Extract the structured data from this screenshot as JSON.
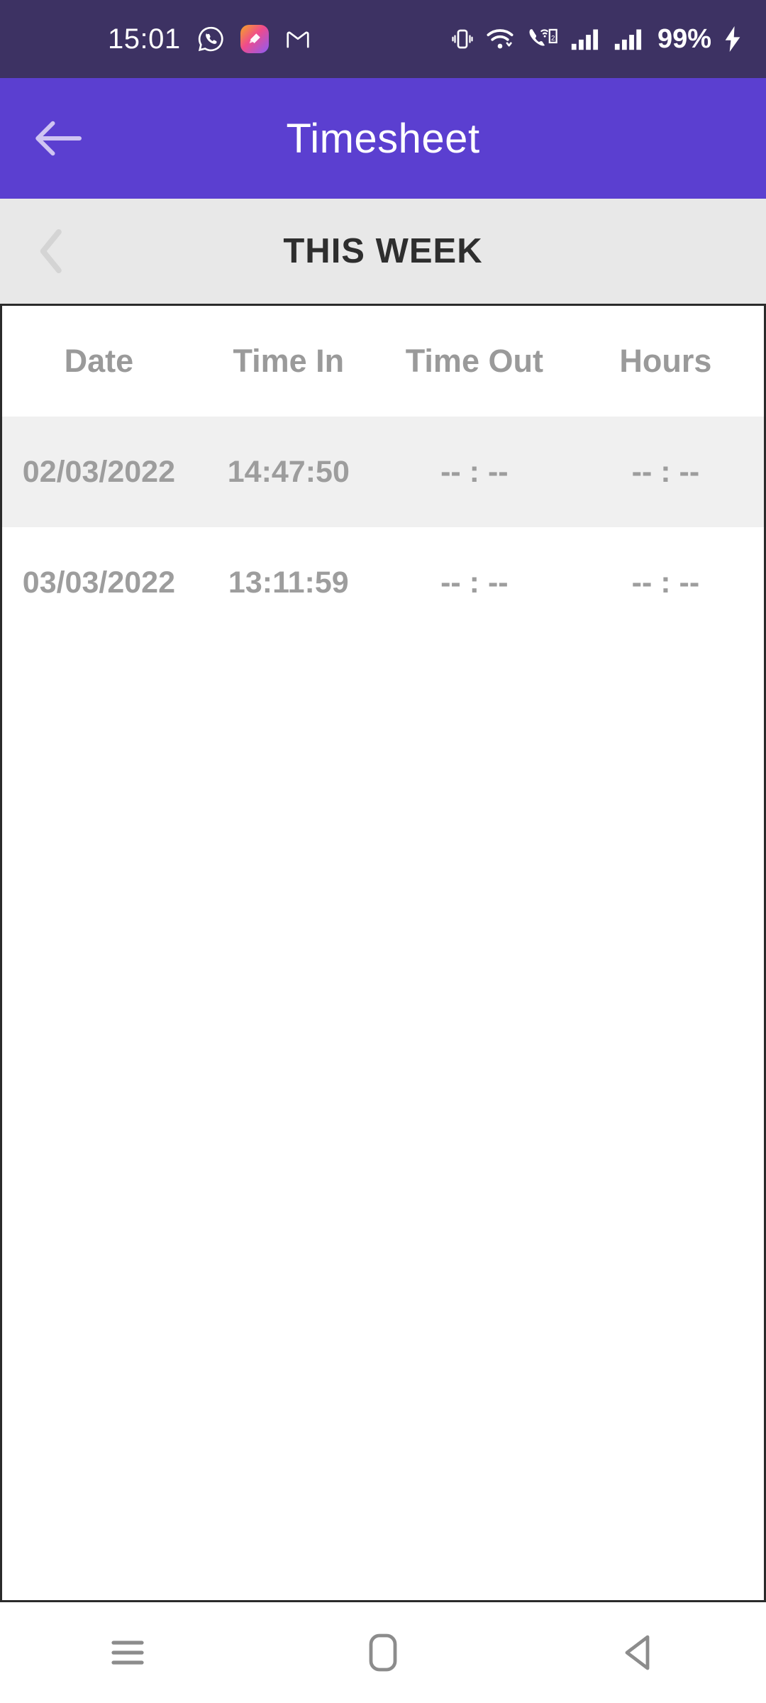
{
  "status_bar": {
    "time": "15:01",
    "battery_percent": "99%",
    "left_icons": [
      "whatsapp-icon",
      "theme-app-icon",
      "gmail-icon"
    ],
    "right_icons": [
      "vibrate-icon",
      "wifi-icon",
      "vowifi-sim2-icon",
      "signal-sim1-icon",
      "signal-sim2-icon",
      "charging-bolt-icon"
    ],
    "background_color": "#3D3263"
  },
  "app_bar": {
    "title": "Timesheet",
    "back_label": "Back",
    "background_color": "#5B3FD0"
  },
  "week_bar": {
    "label": "THIS WEEK",
    "prev_label": "Previous week",
    "background_color": "#E8E8E8"
  },
  "table": {
    "headers": {
      "date": "Date",
      "time_in": "Time In",
      "time_out": "Time Out",
      "hours": "Hours"
    },
    "rows": [
      {
        "date": "02/03/2022",
        "time_in": "14:47:50",
        "time_out": "-- : --",
        "hours": "-- : --"
      },
      {
        "date": "03/03/2022",
        "time_in": "13:11:59",
        "time_out": "-- : --",
        "hours": "-- : --"
      }
    ],
    "border_color": "#2b2b2b",
    "alt_row_color": "#F0F0F0"
  },
  "nav_bar": {
    "recents_label": "Recents",
    "home_label": "Home",
    "back_label": "Back"
  }
}
